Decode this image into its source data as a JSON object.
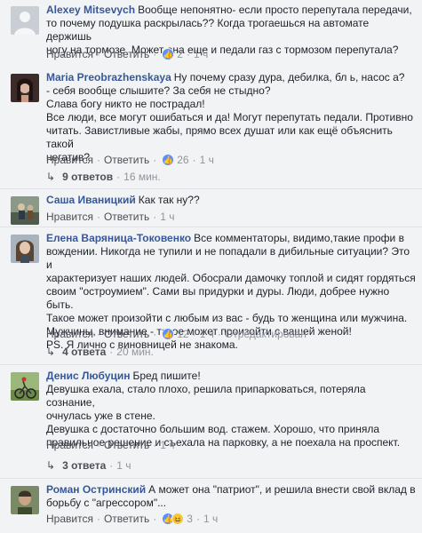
{
  "ui": {
    "like_label": "Нравится",
    "reply_label": "Ответить",
    "dot": "·",
    "like_icon": "👍",
    "haha_icon": "😆",
    "reply_arrow": "↳"
  },
  "comments": [
    {
      "author": "Alexey Mitsevych",
      "text_lines": [
        "Вообще непонятно- если просто перепутала передачи,",
        "то почему подушка раскрылась?? Когда трогаешься на автомате держишь",
        "ногу на тормозе. Может она еще и педали газ с тормозом перепутала?"
      ],
      "reactions": {
        "count": "2",
        "types": [
          "like"
        ]
      },
      "time": "1 ч",
      "avatar_color": "#c9cdd4"
    },
    {
      "author": "Maria Preobrazhenskaya",
      "text_lines": [
        "Ну почему сразу дура, дебилка, бл   ь, насос   а?",
        "- себя вообще слышите? За себя не стыдно?",
        "Слава богу никто не пострадал!",
        "Все люди, все могут ошибаться и да! Могут перепутать педали. Противно",
        "читать. Завистливые жабы, прямо всех душат или как ещё объяснить такой",
        "негатив?"
      ],
      "reactions": {
        "count": "26",
        "types": [
          "like"
        ]
      },
      "time": "1 ч",
      "replies": {
        "text": "9 ответов",
        "time": "16 мин."
      },
      "avatar_color": "#3b2c2a"
    },
    {
      "author": "Саша Иваницкий",
      "text_lines": [
        "Как так ну??"
      ],
      "reactions": {
        "count": "",
        "types": []
      },
      "time": "1 ч",
      "avatar_color": "#6d7a6a"
    },
    {
      "author": "Елена Варяница-Токовенко",
      "text_lines": [
        "Все комментаторы, видимо,такие профи в",
        "вождении. Никогда не тупили и не попадали в дибильные ситуации? Это и",
        "характеризует наших людей. Обосрали дамочку топлой и сидят гордяться",
        "своим \"остроумием\". Сами вы придурки и дуры. Люди, добрее нужно быть.",
        "Такое может произойти с любым из вас - будь то женщина или мужчина.",
        "Мужчины, внимание - такое может произойти с вашей женой!",
        "PS. Я лично с виновницей не знакома."
      ],
      "reactions": {
        "count": "12",
        "types": [
          "like"
        ]
      },
      "time": "1 ч",
      "edited": "Отредактирован",
      "replies": {
        "text": "4 ответа",
        "time": "20 мин."
      },
      "avatar_color": "#7d8a99"
    },
    {
      "author": "Денис Любуцин",
      "text_lines": [
        "Бред пишите!",
        "Девушка ехала, стало плохо, решила припарковаться, потеряла сознание,",
        "очнулась уже в стене.",
        "Девушка с достаточно большим вод. стажем. Хорошо, что приняла",
        "правильное решение и съехала на парковку, а не поехала на проспект."
      ],
      "reactions": {
        "count": "",
        "types": []
      },
      "time": "1 ч",
      "replies": {
        "text": "3 ответа",
        "time": "1 ч"
      },
      "avatar_color": "#5c7a3e"
    },
    {
      "author": "Роман Остринский",
      "text_lines": [
        "А может она \"патриот\", и решила внести свой вклад в",
        "борьбу с \"агрессором\"..."
      ],
      "reactions": {
        "count": "3",
        "types": [
          "like",
          "haha"
        ]
      },
      "time": "1 ч",
      "avatar_color": "#4a5a3c"
    }
  ]
}
